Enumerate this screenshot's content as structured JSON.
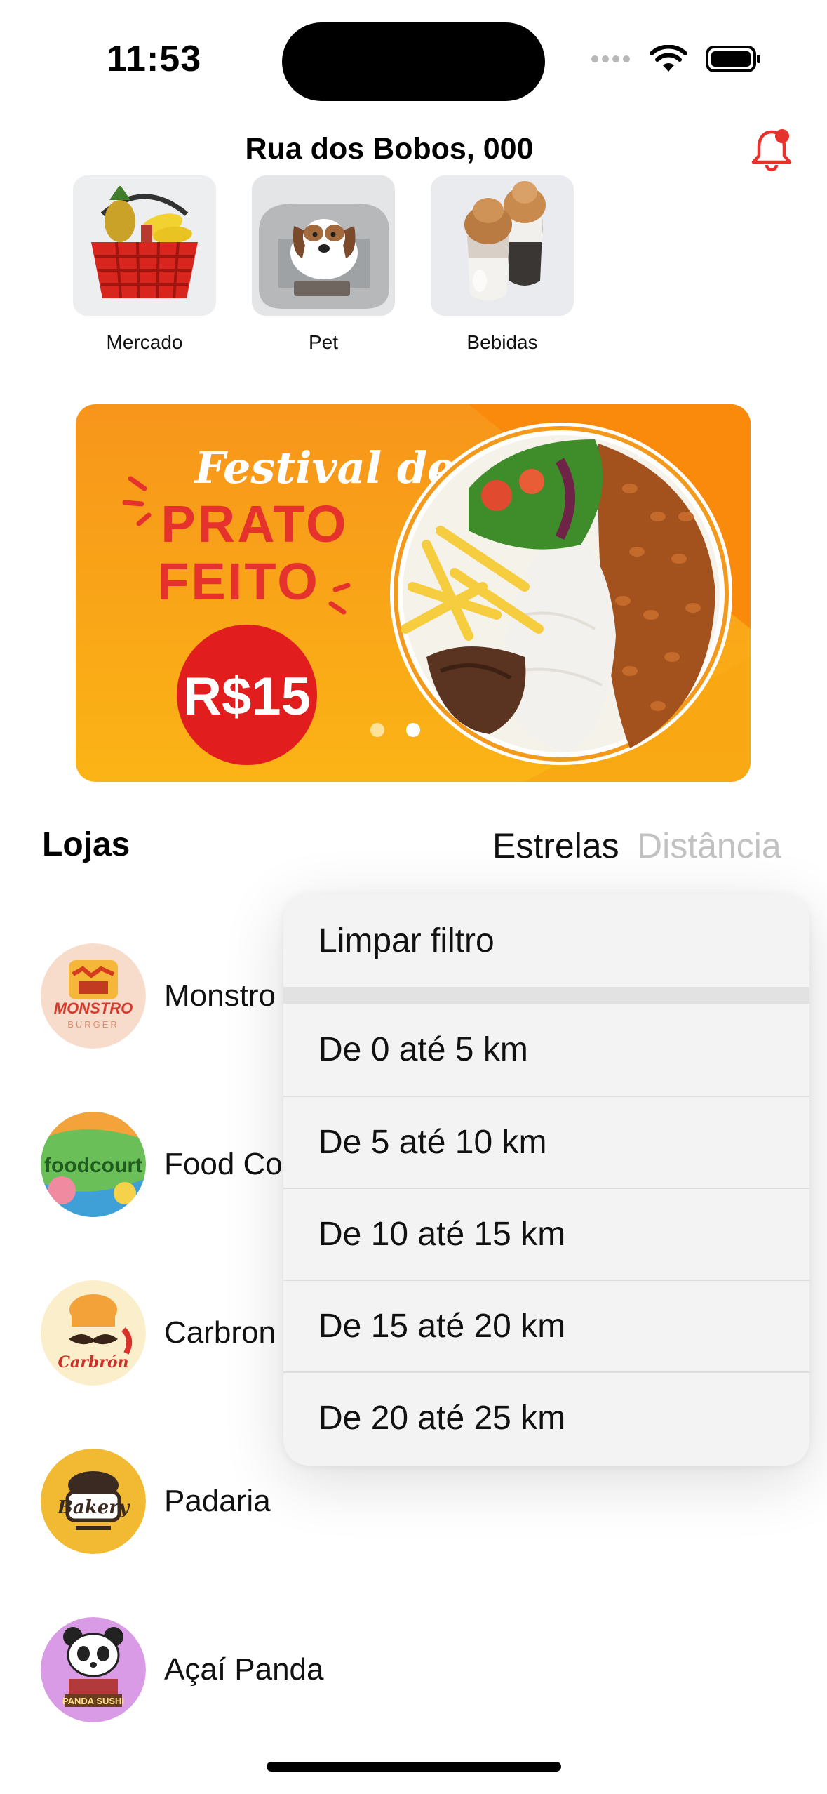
{
  "status_bar": {
    "time": "11:53"
  },
  "header": {
    "address": "Rua dos Bobos, 000"
  },
  "categories": [
    {
      "label": "Mercado",
      "icon": "shopping-basket-image"
    },
    {
      "label": "Pet",
      "icon": "dog-bed-image"
    },
    {
      "label": "Bebidas",
      "icon": "coffee-drinks-image"
    }
  ],
  "banner": {
    "line1": "Festival de",
    "line2": "PRATO",
    "line3": "FEITO",
    "price": "R$15",
    "page_count": 2,
    "active_page": 2
  },
  "stores_section": {
    "title": "Lojas",
    "sort_stars": "Estrelas",
    "sort_distance": "Distância"
  },
  "stores": [
    {
      "name": "Monstro",
      "logo_text": "MONSTRO",
      "logo_sub": "BURGER"
    },
    {
      "name": "Food Co",
      "logo_text": "foodcourt"
    },
    {
      "name": "Carbron",
      "logo_text": "Carbrón"
    },
    {
      "name": "Padaria",
      "logo_text": "Bakery"
    },
    {
      "name": "Açaí Panda",
      "logo_text": "PANDA SUSHI"
    }
  ],
  "distance_menu": {
    "clear_label": "Limpar filtro",
    "options": [
      "De 0 até 5 km",
      "De 5 até 10 km",
      "De 10 até 15 km",
      "De 15 até 20 km",
      "De 20 até 25 km"
    ]
  },
  "colors": {
    "accent_red": "#e5322d",
    "banner_orange": "#f7a11a",
    "inactive_gray": "#c2c2c2"
  }
}
